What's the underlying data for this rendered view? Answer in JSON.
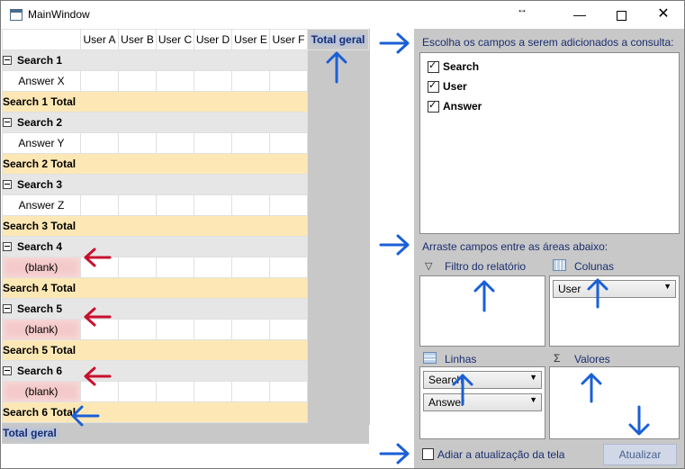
{
  "window": {
    "title": "MainWindow"
  },
  "grid": {
    "columns": [
      "User A",
      "User B",
      "User C",
      "User D",
      "User E",
      "User F"
    ],
    "total_header": "Total geral",
    "groups": [
      {
        "name": "Search 1",
        "answer": "Answer X",
        "total": "Search 1 Total",
        "blank": false
      },
      {
        "name": "Search 2",
        "answer": "Answer Y",
        "total": "Search 2 Total",
        "blank": false
      },
      {
        "name": "Search 3",
        "answer": "Answer Z",
        "total": "Search 3 Total",
        "blank": false
      },
      {
        "name": "Search 4",
        "answer": "(blank)",
        "total": "Search 4 Total",
        "blank": true
      },
      {
        "name": "Search 5",
        "answer": "(blank)",
        "total": "Search 5 Total",
        "blank": true
      },
      {
        "name": "Search 6",
        "answer": "(blank)",
        "total": "Search 6 Total",
        "blank": true
      }
    ],
    "grand_total": "Total geral"
  },
  "panel": {
    "fields_label": "Escolha os campos a serem adicionados a consulta:",
    "fields": [
      {
        "label": "Search",
        "checked": true
      },
      {
        "label": "User",
        "checked": true
      },
      {
        "label": "Answer",
        "checked": true
      }
    ],
    "drag_label": "Arraste campos entre as áreas abaixo:",
    "filter_label": "Filtro do relatório",
    "columns_label": "Colunas",
    "rows_label": "Linhas",
    "values_label": "Valores",
    "columns_items": [
      "User"
    ],
    "rows_items": [
      "Search",
      "Answer"
    ],
    "defer_label": "Adiar a atualização da tela",
    "defer_checked": false,
    "update_button": "Atualizar"
  },
  "colors": {
    "accent_arrow": "#1a5fd6",
    "red_arrow": "#c8102e",
    "total_row": "#fde8b5",
    "blank_cell": "#f4c9c9"
  }
}
